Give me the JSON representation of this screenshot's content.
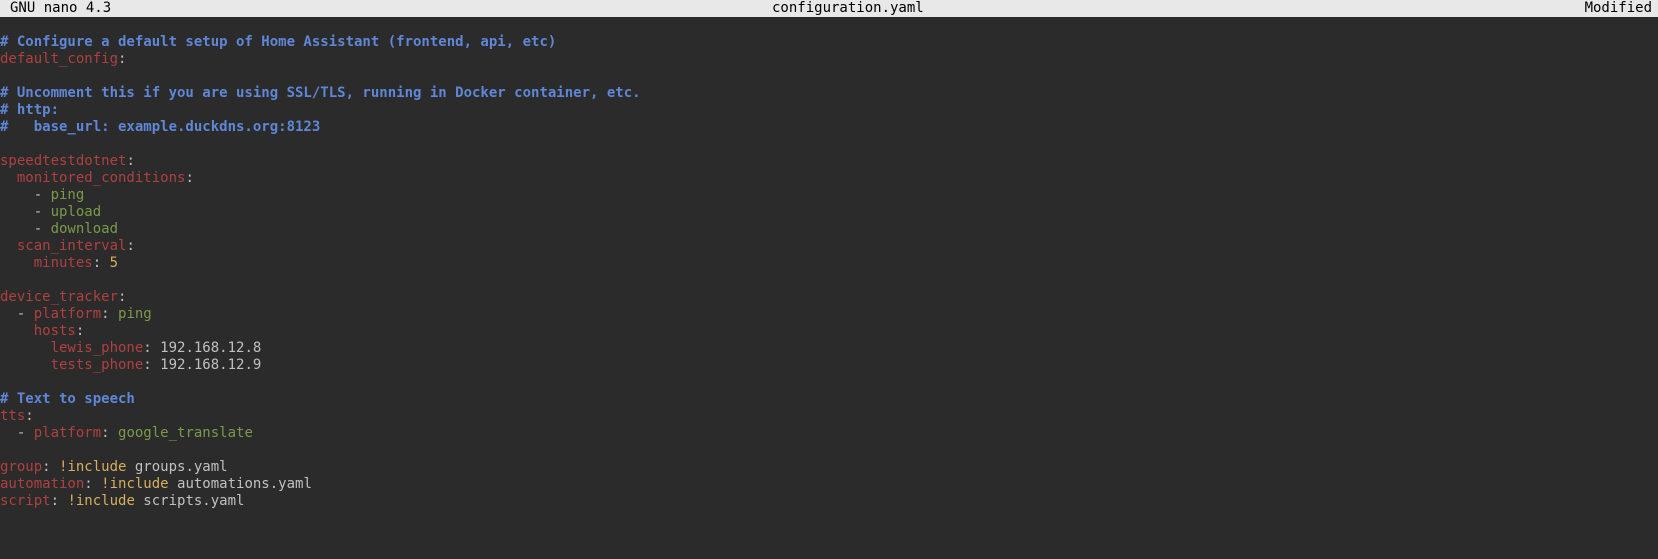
{
  "titlebar": {
    "app": "GNU nano 4.3",
    "filename": "configuration.yaml",
    "status": "Modified"
  },
  "lines": [
    [
      [
        "comment",
        "# Configure a default setup of Home Assistant (frontend, api, etc)"
      ]
    ],
    [
      [
        "key",
        "default_config"
      ],
      [
        "colon",
        ":"
      ]
    ],
    [],
    [
      [
        "comment",
        "# Uncomment this if you are using SSL/TLS, running in Docker container, etc."
      ]
    ],
    [
      [
        "comment",
        "# http:"
      ]
    ],
    [
      [
        "comment",
        "#   base_url: example.duckdns.org:8123"
      ]
    ],
    [],
    [
      [
        "key",
        "speedtestdotnet"
      ],
      [
        "colon",
        ":"
      ]
    ],
    [
      [
        "plain",
        "  "
      ],
      [
        "key",
        "monitored_conditions"
      ],
      [
        "colon",
        ":"
      ]
    ],
    [
      [
        "plain",
        "    "
      ],
      [
        "dash",
        "- "
      ],
      [
        "value",
        "ping"
      ]
    ],
    [
      [
        "plain",
        "    "
      ],
      [
        "dash",
        "- "
      ],
      [
        "value",
        "upload"
      ]
    ],
    [
      [
        "plain",
        "    "
      ],
      [
        "dash",
        "- "
      ],
      [
        "value",
        "download"
      ]
    ],
    [
      [
        "plain",
        "  "
      ],
      [
        "key",
        "scan_interval"
      ],
      [
        "colon",
        ":"
      ]
    ],
    [
      [
        "plain",
        "    "
      ],
      [
        "key",
        "minutes"
      ],
      [
        "colon",
        ": "
      ],
      [
        "number",
        "5"
      ]
    ],
    [],
    [
      [
        "key",
        "device_tracker"
      ],
      [
        "colon",
        ":"
      ]
    ],
    [
      [
        "plain",
        "  "
      ],
      [
        "dash",
        "- "
      ],
      [
        "key",
        "platform"
      ],
      [
        "colon",
        ": "
      ],
      [
        "value",
        "ping"
      ]
    ],
    [
      [
        "plain",
        "    "
      ],
      [
        "key",
        "hosts"
      ],
      [
        "colon",
        ":"
      ]
    ],
    [
      [
        "plain",
        "      "
      ],
      [
        "key",
        "lewis_phone"
      ],
      [
        "colon",
        ": "
      ],
      [
        "plain",
        "192.168.12.8"
      ]
    ],
    [
      [
        "plain",
        "      "
      ],
      [
        "key",
        "tests_phone"
      ],
      [
        "colon",
        ": "
      ],
      [
        "plain",
        "192.168.12.9"
      ]
    ],
    [],
    [
      [
        "comment",
        "# Text to speech"
      ]
    ],
    [
      [
        "key",
        "tts"
      ],
      [
        "colon",
        ":"
      ]
    ],
    [
      [
        "plain",
        "  "
      ],
      [
        "dash",
        "- "
      ],
      [
        "key",
        "platform"
      ],
      [
        "colon",
        ": "
      ],
      [
        "value",
        "google_translate"
      ]
    ],
    [],
    [
      [
        "key",
        "group"
      ],
      [
        "colon",
        ": "
      ],
      [
        "tag",
        "!include"
      ],
      [
        "plain",
        " groups.yaml"
      ]
    ],
    [
      [
        "key",
        "automation"
      ],
      [
        "colon",
        ": "
      ],
      [
        "tag",
        "!include"
      ],
      [
        "plain",
        " automations.yaml"
      ]
    ],
    [
      [
        "key",
        "script"
      ],
      [
        "colon",
        ": "
      ],
      [
        "tag",
        "!include"
      ],
      [
        "plain",
        " scripts.yaml"
      ]
    ]
  ]
}
